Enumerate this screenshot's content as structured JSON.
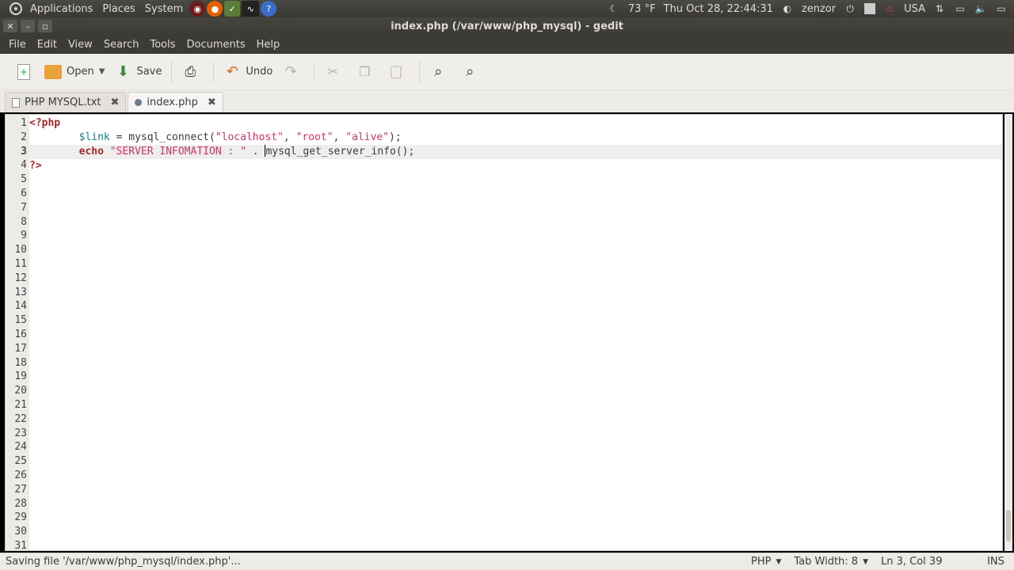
{
  "panel": {
    "menus": [
      "Applications",
      "Places",
      "System"
    ],
    "weather": "73 °F",
    "datetime": "Thu Oct 28, 22:44:31",
    "user": "zenzor",
    "keyboard": "USA"
  },
  "window": {
    "title": "index.php (/var/www/php_mysql) - gedit"
  },
  "menubar": [
    "File",
    "Edit",
    "View",
    "Search",
    "Tools",
    "Documents",
    "Help"
  ],
  "toolbar": {
    "open_label": "Open",
    "save_label": "Save",
    "undo_label": "Undo"
  },
  "tabs": [
    {
      "label": "PHP MYSQL.txt",
      "active": false
    },
    {
      "label": "index.php",
      "active": true
    }
  ],
  "editor": {
    "code_lines": [
      "<?php",
      "        $link = mysql_connect(\"localhost\", \"root\", \"alive\");",
      "        echo \"SERVER INFOMATION : \" . mysql_get_server_info();",
      "?>"
    ],
    "line_numbers": [
      "1",
      "2",
      "3",
      "4",
      "5",
      "6",
      "7",
      "8",
      "9",
      "10",
      "11",
      "12",
      "13",
      "14",
      "15",
      "16",
      "17",
      "18",
      "19",
      "20",
      "21",
      "22",
      "23",
      "24",
      "25",
      "26",
      "27",
      "28",
      "29",
      "30",
      "31"
    ],
    "current_line": 3
  },
  "statusbar": {
    "message": "Saving file '/var/www/php_mysql/index.php'...",
    "language": "PHP",
    "tab_width": "Tab Width: 8",
    "position": "Ln 3, Col 39",
    "mode": "INS"
  }
}
